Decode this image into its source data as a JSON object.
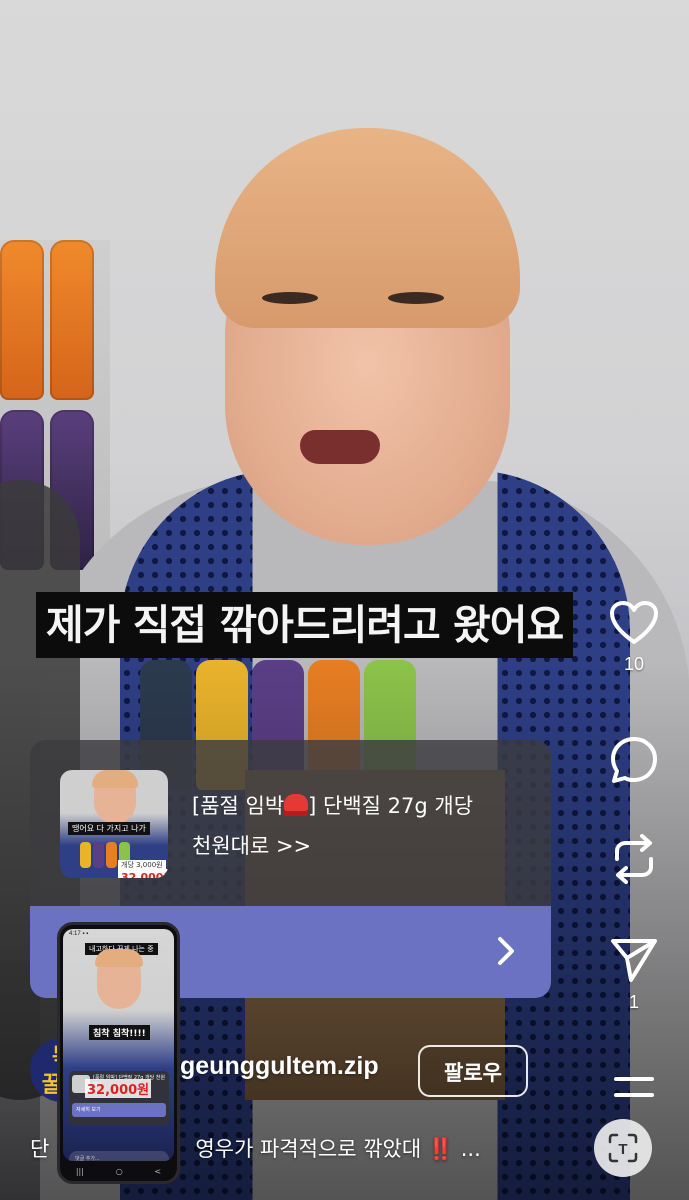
{
  "video": {
    "caption": "제가 직접 깎아드리려고 왔어요"
  },
  "actions": {
    "like": {
      "icon": "heart-icon",
      "count": "10"
    },
    "comment": {
      "icon": "comment-icon"
    },
    "repost": {
      "icon": "repost-icon"
    },
    "share": {
      "icon": "send-icon",
      "count": "1"
    },
    "more": {
      "icon": "menu-icon"
    }
  },
  "promo": {
    "text_before_emoji": "[품절 임박",
    "emoji": "siren-emoji",
    "text_after_emoji": "] 단백질 27g 개당",
    "text_line2": "천원대로 >>",
    "thumbnail_caption": "땡어요 다 가지고 나가",
    "thumbnail_price_label": "개당 3,000원",
    "thumbnail_price": "32,000원",
    "button_icon": "chevron-right-icon"
  },
  "account": {
    "avatar_text_1": "득",
    "avatar_text_2": "꿀템",
    "username": "geunggultem.zip",
    "follow_label": "팔로우"
  },
  "description": {
    "text_start": "단",
    "text_end": "영우가 파격적으로 깎았대",
    "emphasis": "‼️",
    "ellipsis": "..."
  },
  "phone_preview": {
    "status": "4:17 ▪ ▪",
    "top_caption": "내고하다 꾸게 나는 중",
    "caption": "침착 침착!!!!",
    "price": "32,000원",
    "promo_text": "[품절 임박] 단백질 27g 개당 천원대로",
    "promo_button": "자세히 보기",
    "comment_placeholder": "댓글 추가...",
    "nav": [
      "|||",
      "○",
      "<"
    ]
  },
  "text_lens": {
    "icon": "text-scan-icon",
    "label": "T"
  },
  "colors": {
    "promo_button": "#6b72c2",
    "promo_card": "#3c3c40",
    "caption_bg": "#0c0c0c",
    "emphasis": "#ff2d55"
  }
}
